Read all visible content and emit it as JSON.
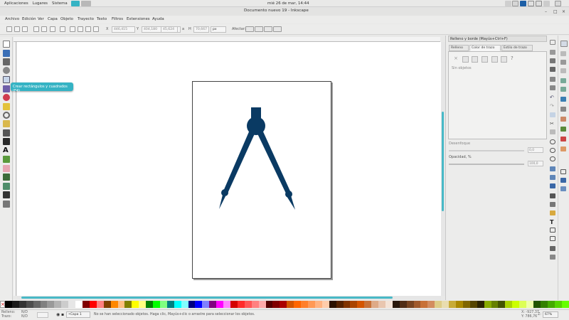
{
  "system_bar": {
    "menus": [
      "Aplicaciones",
      "Lugares",
      "Sistema"
    ],
    "clock": "mié 26 de mar, 14:44"
  },
  "window": {
    "title": "Documento nuevo 19 - Inkscape"
  },
  "menu": {
    "items": [
      "Archivo",
      "Edición",
      "Ver",
      "Capa",
      "Objeto",
      "Trayecto",
      "Texto",
      "Filtros",
      "Extensiones",
      "Ayuda"
    ]
  },
  "toolbar": {
    "x_value": "446,415",
    "y_value": "404,180",
    "w_value": "45,624",
    "h_value": "70,667",
    "unit": "px",
    "affect_label": "Afectar:"
  },
  "tooltip": {
    "text": "Crear rectángulos y cuadrados (F4)"
  },
  "panel": {
    "title": "Relleno y borde (Mayús+Ctrl+F)",
    "tabs": [
      "Relleno",
      "Color de trazo",
      "Estilo de trazo"
    ],
    "no_objects": "Sin objetos",
    "blur_label": "Desenfoque",
    "blur_value": "0,0",
    "opacity_label": "Opacidad, %",
    "opacity_value": "100,0"
  },
  "status": {
    "fill_label": "Relleno:",
    "stroke_label": "Trazo:",
    "fill_value": "N/D",
    "stroke_value": "N/D",
    "layer": "•Capa 1",
    "message": "No se han seleccionado objetos. Haga clic, Mayús+clic o arrastre para seleccionar los objetos.",
    "x_coord": "X: -927,37",
    "y_coord": "Y: 786,76",
    "zoom": "67%"
  },
  "colors": {
    "accent": "#48b9c7",
    "compass": "#0a3a63"
  }
}
